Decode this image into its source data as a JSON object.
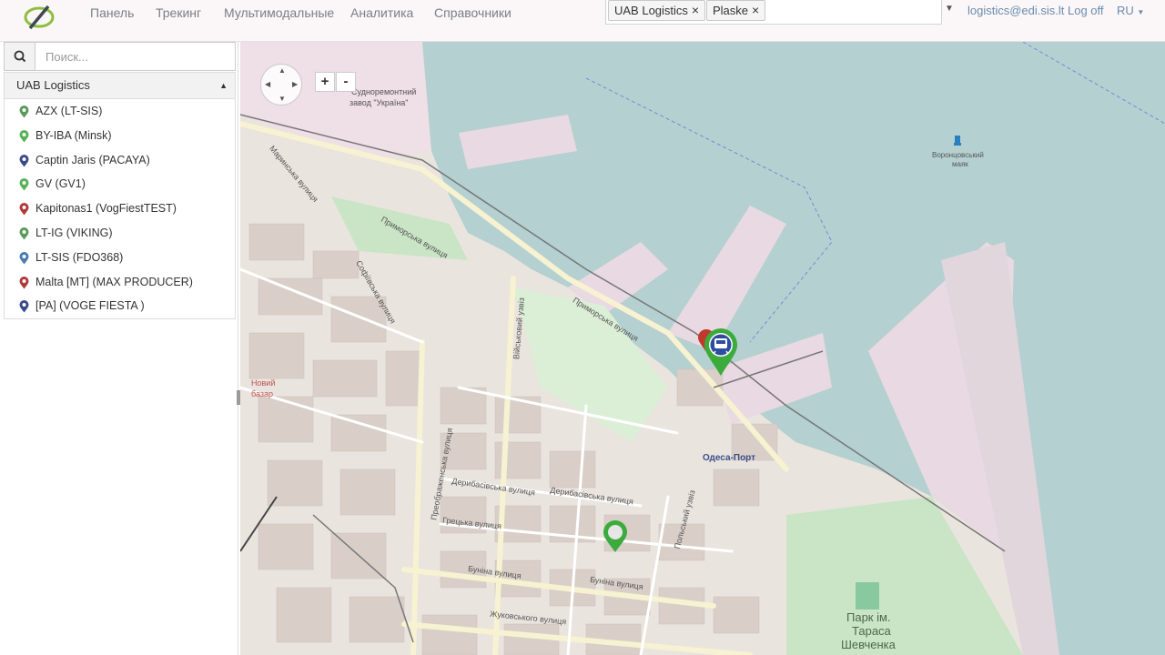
{
  "nav": {
    "items": [
      "Панель",
      "Трекинг",
      "Мультимодальные",
      "Аналитика",
      "Справочники"
    ],
    "filter_tags": [
      "UAB Logistics",
      "Plaske"
    ],
    "user": "logistics@edi.sis.lt Log off",
    "language": "RU"
  },
  "sidebar": {
    "search_placeholder": "Поиск...",
    "group_title": "UAB Logistics",
    "items": [
      {
        "label": "AZX (LT-SIS)",
        "pin_color": "#5a9a5a"
      },
      {
        "label": "BY-IBA (Minsk)",
        "pin_color": "#56b256"
      },
      {
        "label": "Captin Jaris (PACAYA)",
        "pin_color": "#3b4a8a"
      },
      {
        "label": "GV (GV1)",
        "pin_color": "#56b256"
      },
      {
        "label": "Kapitonas1 (VogFiestTEST)",
        "pin_color": "#b03a3a"
      },
      {
        "label": "LT-IG (VIKING)",
        "pin_color": "#5a9a5a"
      },
      {
        "label": "LT-SIS (FDO368)",
        "pin_color": "#4a7ab0"
      },
      {
        "label": "Malta [MT] (MAX PRODUCER)",
        "pin_color": "#b03a3a"
      },
      {
        "label": "[PA] (VOGE FIESTA )",
        "pin_color": "#3b4a8a"
      }
    ]
  },
  "map": {
    "zoom_in": "+",
    "zoom_out": "-",
    "labels": {
      "sudnoremont": "Судноремонтний",
      "zavod": "завод \"Україна\"",
      "vorontsov1": "Воронцовський",
      "vorontsov2": "маяк",
      "primorska1": "Приморська вулиця",
      "primorska2": "Приморська вулиця",
      "mariinska": "Маринська вулиця",
      "sofiivska": "Софіївська вулиця",
      "odesa_port": "Одеса-Порт",
      "deribasivska1": "Дерибасівська вулиця",
      "deribasivska2": "Дерибасівська вулиця",
      "hretska": "Грецька вулиця",
      "bunina1": "Буніна вулиця",
      "bunina2": "Буніна вулиця",
      "zhukovskoho": "Жуковського вулиця",
      "preobrazhenska": "Преображенська вулиця",
      "polskyi": "Польський узвіз",
      "viiskovyi": "Військовий узвіз",
      "novyi_bazar1": "Новий",
      "novyi_bazar2": "базар",
      "park1": "Парк ім.",
      "park2": "Тараса",
      "park3": "Шевченка"
    }
  },
  "colors": {
    "sea": "#b5d0d0",
    "land": "#eae4df",
    "pin_green": "#4fae4f",
    "link": "#6a8caf"
  }
}
